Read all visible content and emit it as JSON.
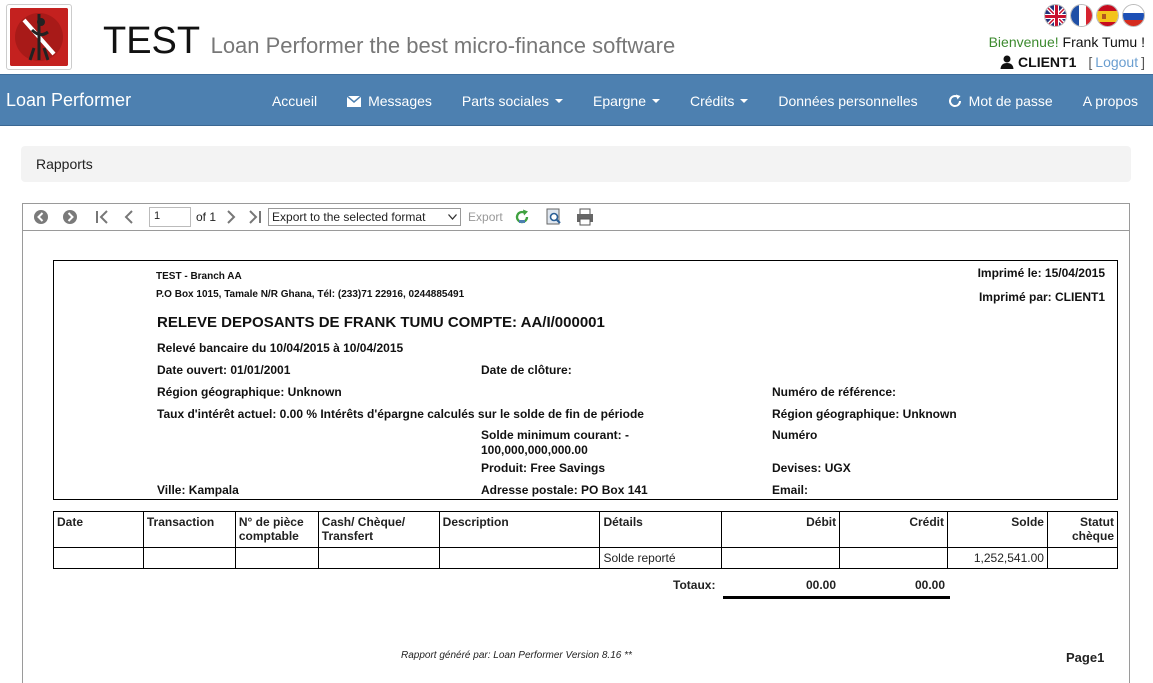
{
  "header": {
    "brand": "TEST",
    "tagline": "Loan Performer the best micro-finance software",
    "flags": [
      "english-flag",
      "french-flag",
      "spanish-flag",
      "russian-flag"
    ],
    "welcome_label": "Bienvenue!",
    "welcome_name": "Frank Tumu !",
    "username": "CLIENT1",
    "bracket_open": "[",
    "logout": "Logout",
    "bracket_close": "]"
  },
  "nav": {
    "brand": "Loan Performer",
    "items": [
      {
        "label": "Accueil",
        "icon": "",
        "dropdown": false
      },
      {
        "label": "Messages",
        "icon": "envelope-icon",
        "dropdown": false
      },
      {
        "label": "Parts sociales",
        "icon": "",
        "dropdown": true
      },
      {
        "label": "Epargne",
        "icon": "",
        "dropdown": true
      },
      {
        "label": "Crédits",
        "icon": "",
        "dropdown": true
      },
      {
        "label": "Données personnelles",
        "icon": "",
        "dropdown": false
      },
      {
        "label": "Mot de passe",
        "icon": "refresh-icon",
        "dropdown": false
      },
      {
        "label": "A propos",
        "icon": "",
        "dropdown": false
      }
    ]
  },
  "breadcrumb": "Rapports",
  "toolbar": {
    "page_value": "1",
    "of_label": "of 1",
    "format_select": "Export to the selected format",
    "export_label": "Export"
  },
  "report": {
    "branch": "TEST - Branch AA",
    "address": "P.O Box 1015, Tamale N/R Ghana, Tél: (233)71 22916, 0244885491",
    "printed_on": "Imprimé le: 15/04/2015",
    "printed_by": "Imprimé par: CLIENT1",
    "title": "RELEVE DEPOSANTS DE FRANK  TUMU  COMPTE: AA/I/000001",
    "period": "Relevé bancaire du 10/04/2015 à 10/04/2015",
    "date_opened": "Date ouvert: 01/01/2001",
    "date_closed": "Date de clôture:",
    "region_left": "Région géographique: Unknown",
    "reference_number": "Numéro de référence:",
    "interest": "Taux d'intérêt actuel: 0.00 % Intérêts d'épargne calculés sur le solde de fin de période",
    "region_right": "Région géographique: Unknown",
    "min_balance_1": "Solde minimum courant: -",
    "min_balance_2": "100,000,000,000.00",
    "number": "Numéro",
    "product": "Produit: Free Savings",
    "currency": "Devises: UGX",
    "city": "Ville: Kampala",
    "postal_address": "Adresse postale: PO Box 141",
    "email": "Email:"
  },
  "table": {
    "headers": [
      "Date",
      "Transaction",
      "N° de pièce comptable",
      "Cash/ Chèque/ Transfert",
      "Description",
      "Détails",
      "Débit",
      "Crédit",
      "Solde",
      "Statut chèque"
    ],
    "rows": [
      [
        "",
        "",
        "",
        "",
        "",
        "Solde reporté",
        "",
        "",
        "1,252,541.00",
        ""
      ]
    ],
    "totals_label": "Totaux:",
    "total_debit": "00.00",
    "total_credit": "00.00"
  },
  "footer": {
    "generated_by": "Rapport généré par: Loan Performer Version 8.16 **",
    "page": "Page1"
  }
}
